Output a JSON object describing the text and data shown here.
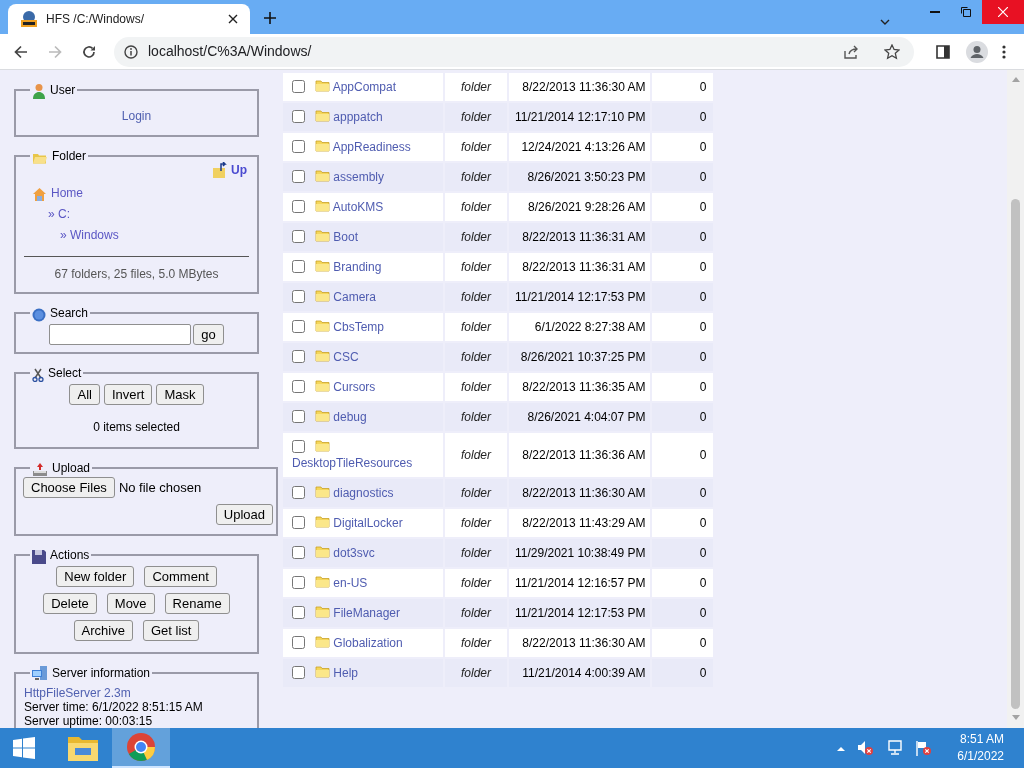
{
  "browser": {
    "tab_title": "HFS /C:/Windows/",
    "url": "localhost/C%3A/Windows/"
  },
  "sidebar": {
    "user": {
      "legend": "User",
      "login": "Login"
    },
    "folder": {
      "legend": "Folder",
      "up": "Up",
      "path": [
        {
          "label": "Home",
          "children": [
            {
              "label": "» C:",
              "children": [
                {
                  "label": "» Windows"
                }
              ]
            }
          ]
        }
      ],
      "summary": "67 folders, 25 files, 5.0 MBytes"
    },
    "search": {
      "legend": "Search",
      "button": "go"
    },
    "select": {
      "legend": "Select",
      "buttons": [
        "All",
        "Invert",
        "Mask"
      ],
      "status": "0 items selected"
    },
    "upload": {
      "legend": "Upload",
      "choose_button": "Choose Files",
      "file_status": "No file chosen",
      "upload_button": "Upload"
    },
    "actions": {
      "legend": "Actions",
      "button_rows": [
        [
          "New folder",
          "Comment"
        ],
        [
          "Delete",
          "Move",
          "Rename"
        ],
        [
          "Archive",
          "Get list"
        ]
      ]
    },
    "server_info": {
      "legend": "Server information",
      "link": "HttpFileServer 2.3m",
      "lines": [
        "Server time: 6/1/2022 8:51:15 AM",
        "Server uptime: 00:03:15"
      ]
    }
  },
  "files": {
    "rows": [
      {
        "name": "AppCompat",
        "type": "folder",
        "modified": "8/22/2013 11:36:30 AM",
        "size": "0",
        "checked": false
      },
      {
        "name": "apppatch",
        "type": "folder",
        "modified": "11/21/2014 12:17:10 PM",
        "size": "0",
        "checked": false
      },
      {
        "name": "AppReadiness",
        "type": "folder",
        "modified": "12/24/2021 4:13:26 AM",
        "size": "0",
        "checked": false
      },
      {
        "name": "assembly",
        "type": "folder",
        "modified": "8/26/2021 3:50:23 PM",
        "size": "0",
        "checked": false
      },
      {
        "name": "AutoKMS",
        "type": "folder",
        "modified": "8/26/2021 9:28:26 AM",
        "size": "0",
        "checked": false
      },
      {
        "name": "Boot",
        "type": "folder",
        "modified": "8/22/2013 11:36:31 AM",
        "size": "0",
        "checked": false
      },
      {
        "name": "Branding",
        "type": "folder",
        "modified": "8/22/2013 11:36:31 AM",
        "size": "0",
        "checked": false
      },
      {
        "name": "Camera",
        "type": "folder",
        "modified": "11/21/2014 12:17:53 PM",
        "size": "0",
        "checked": false
      },
      {
        "name": "CbsTemp",
        "type": "folder",
        "modified": "6/1/2022 8:27:38 AM",
        "size": "0",
        "checked": false
      },
      {
        "name": "CSC",
        "type": "folder",
        "modified": "8/26/2021 10:37:25 PM",
        "size": "0",
        "checked": false
      },
      {
        "name": "Cursors",
        "type": "folder",
        "modified": "8/22/2013 11:36:35 AM",
        "size": "0",
        "checked": false
      },
      {
        "name": "debug",
        "type": "folder",
        "modified": "8/26/2021 4:04:07 PM",
        "size": "0",
        "checked": false
      },
      {
        "name": "DesktopTileResources",
        "type": "folder",
        "modified": "8/22/2013 11:36:36 AM",
        "size": "0",
        "checked": false
      },
      {
        "name": "diagnostics",
        "type": "folder",
        "modified": "8/22/2013 11:36:30 AM",
        "size": "0",
        "checked": false
      },
      {
        "name": "DigitalLocker",
        "type": "folder",
        "modified": "8/22/2013 11:43:29 AM",
        "size": "0",
        "checked": false
      },
      {
        "name": "dot3svc",
        "type": "folder",
        "modified": "11/29/2021 10:38:49 PM",
        "size": "0",
        "checked": false
      },
      {
        "name": "en-US",
        "type": "folder",
        "modified": "11/21/2014 12:16:57 PM",
        "size": "0",
        "checked": false
      },
      {
        "name": "FileManager",
        "type": "folder",
        "modified": "11/21/2014 12:17:53 PM",
        "size": "0",
        "checked": false
      },
      {
        "name": "Globalization",
        "type": "folder",
        "modified": "8/22/2013 11:36:30 AM",
        "size": "0",
        "checked": false
      },
      {
        "name": "Help",
        "type": "folder",
        "modified": "11/21/2014 4:00:39 AM",
        "size": "0",
        "checked": false
      }
    ]
  },
  "taskbar": {
    "apps": [
      {
        "kind": "explorer",
        "selected": false
      },
      {
        "kind": "browser",
        "selected": true
      }
    ],
    "clock_time": "8:51 AM",
    "clock_date": "6/1/2022"
  }
}
